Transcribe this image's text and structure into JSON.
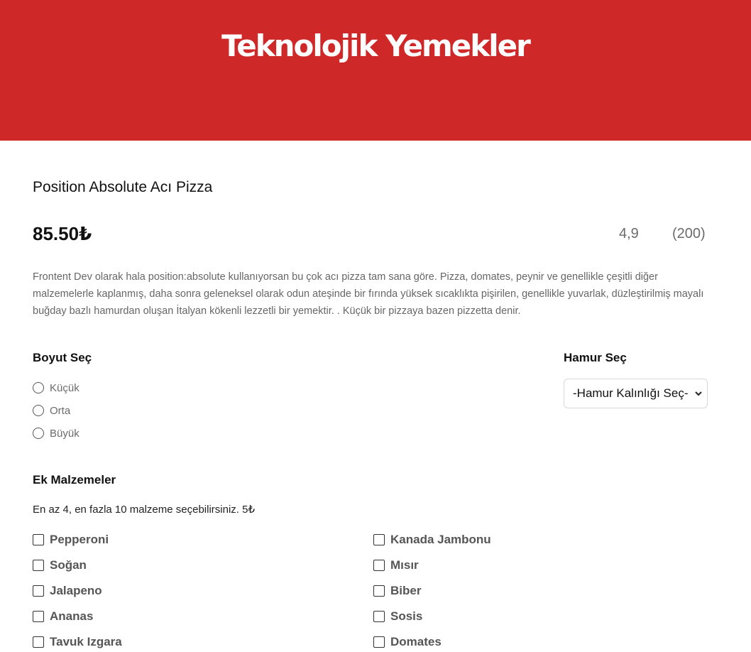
{
  "header": {
    "brand": "Teknolojik Yemekler",
    "bg_color": "#ce2829"
  },
  "product": {
    "title": "Position Absolute Acı Pizza",
    "price": "85.50₺",
    "rating": "4,9",
    "reviews": "(200)",
    "description": "Frontent Dev olarak hala position:absolute kullanıyorsan bu çok acı pizza tam sana göre. Pizza, domates, peynir ve genellikle çeşitli diğer malzemelerle kaplanmış, daha sonra geleneksel olarak odun ateşinde bir fırında yüksek sıcaklıkta pişirilen, genellikle yuvarlak, düzleştirilmiş mayalı buğday bazlı hamurdan oluşan İtalyan kökenli lezzetli bir yemektir. . Küçük bir pizzaya bazen pizzetta denir."
  },
  "size": {
    "title": "Boyut Seç",
    "options": [
      "Küçük",
      "Orta",
      "Büyük"
    ]
  },
  "dough": {
    "title": "Hamur Seç",
    "selected": "-Hamur Kalınlığı Seç-"
  },
  "toppings": {
    "title": "Ek Malzemeler",
    "hint": "En az 4, en fazla 10 malzeme seçebilirsiniz. 5₺",
    "left": [
      "Pepperoni",
      "Soğan",
      "Jalapeno",
      "Ananas",
      "Tavuk Izgara"
    ],
    "right": [
      "Kanada Jambonu",
      "Mısır",
      "Biber",
      "Sosis",
      "Domates"
    ]
  }
}
